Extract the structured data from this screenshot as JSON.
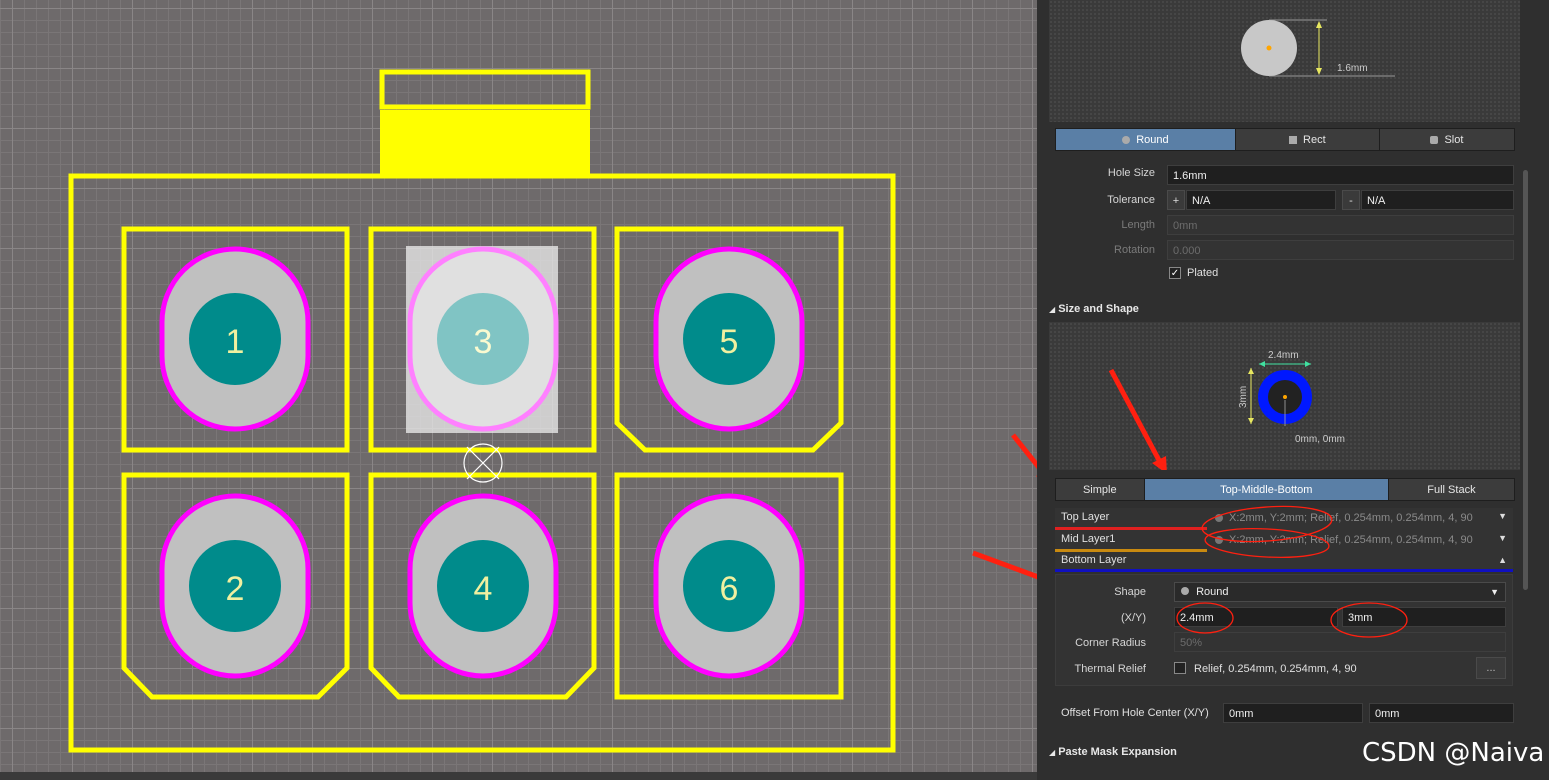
{
  "pads": [
    {
      "label": "1"
    },
    {
      "label": "2"
    },
    {
      "label": "3"
    },
    {
      "label": "4"
    },
    {
      "label": "5"
    },
    {
      "label": "6"
    }
  ],
  "hole_preview": {
    "dimension": "1.6mm"
  },
  "hole_shape_tabs": {
    "round": "Round",
    "rect": "Rect",
    "slot": "Slot",
    "active": "Round"
  },
  "hole_fields": {
    "hole_size_label": "Hole Size",
    "hole_size_value": "1.6mm",
    "tolerance_label": "Tolerance",
    "tolerance_plus": "+",
    "tolerance_plus_value": "N/A",
    "tolerance_minus": "-",
    "tolerance_minus_value": "N/A",
    "length_label": "Length",
    "length_value": "0mm",
    "rotation_label": "Rotation",
    "rotation_value": "0.000",
    "plated_label": "Plated",
    "plated_checked": true
  },
  "size_and_shape": {
    "title": "Size and Shape",
    "preview_width": "2.4mm",
    "preview_height": "3mm",
    "preview_offset": "0mm, 0mm",
    "mode_tabs": {
      "simple": "Simple",
      "tmb": "Top-Middle-Bottom",
      "full": "Full Stack",
      "active": "Top-Middle-Bottom"
    },
    "layers": [
      {
        "name": "Top Layer",
        "value": "X:2mm, Y:2mm; Relief, 0.254mm, 0.254mm, 4, 90",
        "color": "#e02020"
      },
      {
        "name": "Mid Layer1",
        "value": "X:2mm, Y:2mm; Relief, 0.254mm, 0.254mm, 4, 90",
        "color": "#c98a10"
      },
      {
        "name": "Bottom Layer",
        "value": "",
        "color": "#1010c0"
      }
    ],
    "shape_label": "Shape",
    "shape_value": "Round",
    "xy_label": "(X/Y)",
    "x_value": "2.4mm",
    "y_value": "3mm",
    "corner_radius_label": "Corner Radius",
    "corner_radius_value": "50%",
    "thermal_relief_label": "Thermal Relief",
    "thermal_relief_value": "Relief, 0.254mm, 0.254mm, 4, 90",
    "thermal_button": "...",
    "offset_label": "Offset From Hole Center (X/Y)",
    "offset_x": "0mm",
    "offset_y": "0mm"
  },
  "paste_mask": {
    "title": "Paste Mask Expansion"
  },
  "watermark": "CSDN @Naiva",
  "colors": {
    "silkscreen": "#ffff00",
    "pad_outline": "#ff00ff",
    "pad_copper": "#c0c0c0",
    "hole": "#008b8b",
    "annotation_arrow": "#ff2010"
  }
}
